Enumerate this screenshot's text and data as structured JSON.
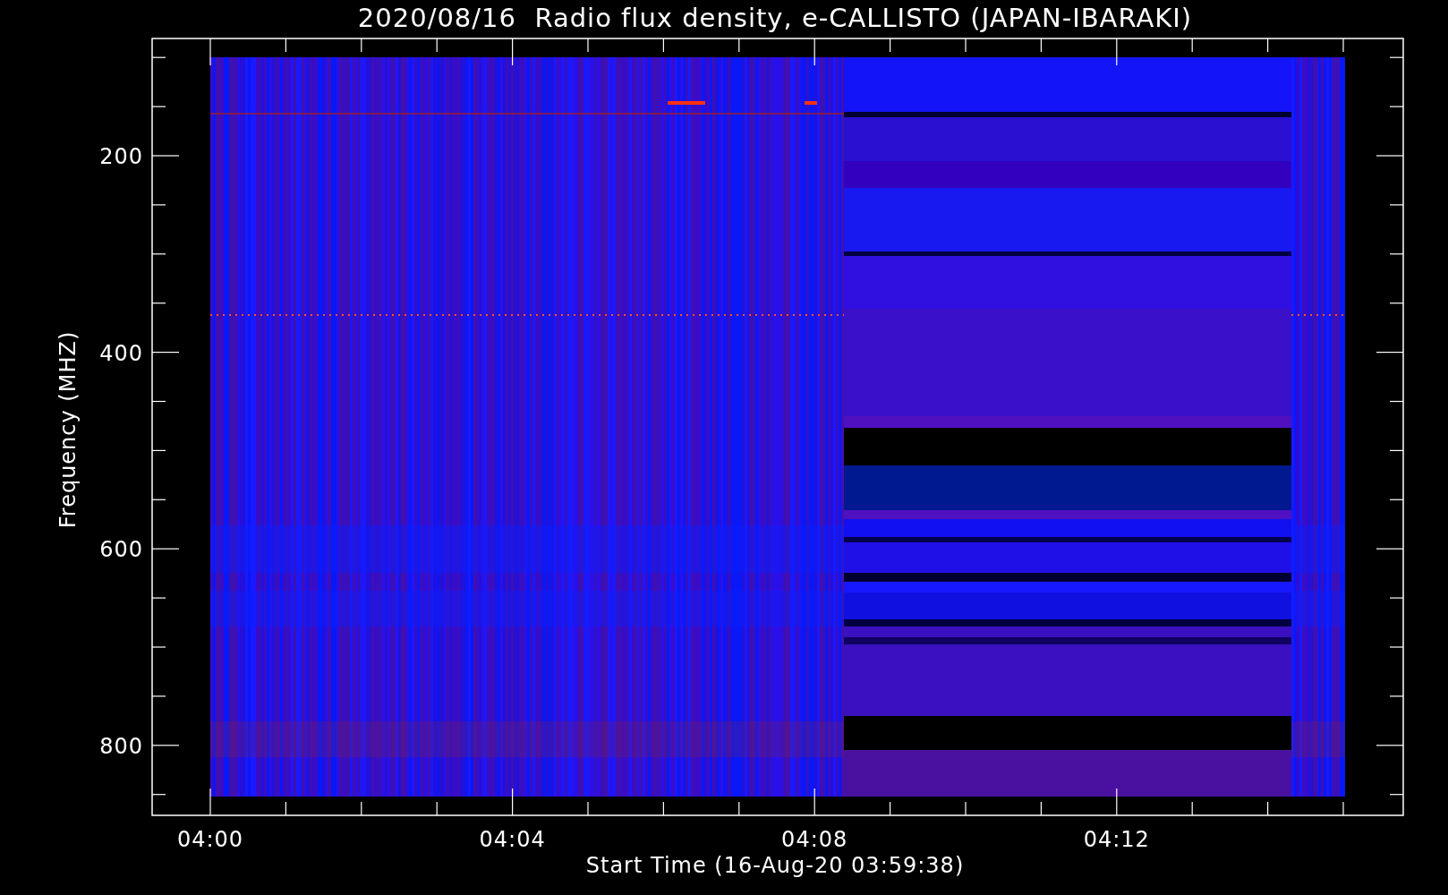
{
  "title": "2020/08/16  Radio flux density, e-CALLISTO (JAPAN-IBARAKI)",
  "y_axis": {
    "label": "Frequency (MHZ)",
    "ticks": [
      "200",
      "400",
      "600",
      "800"
    ]
  },
  "x_axis": {
    "label": "Start Time (16-Aug-20 03:59:38)",
    "ticks": [
      "04:00",
      "04:04",
      "04:08",
      "04:12"
    ]
  }
}
